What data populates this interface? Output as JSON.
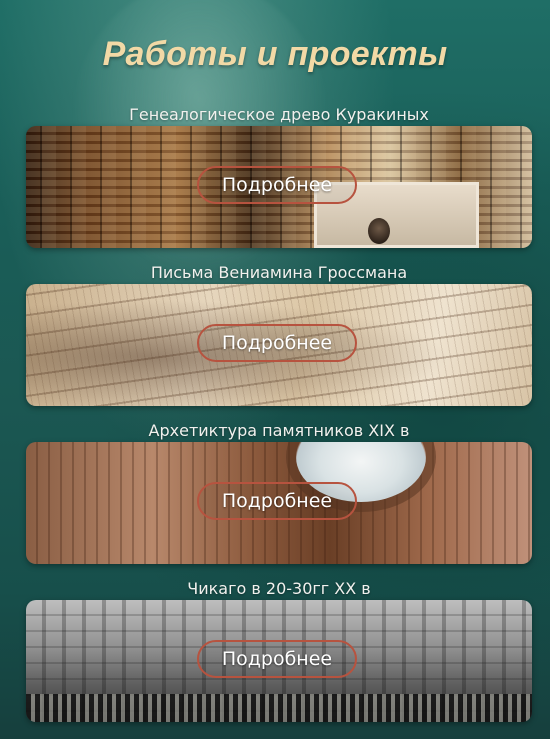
{
  "page": {
    "title": "Работы и проекты"
  },
  "projects": [
    {
      "title": "Генеалогическое древо Куракиных",
      "button_label": "Подробнее",
      "image": "old-books-and-photo"
    },
    {
      "title": "Письма Вениамина Гроссмана",
      "button_label": "Подробнее",
      "image": "handwritten-letters"
    },
    {
      "title": "Архетиктура памятников XIX в",
      "button_label": "Подробнее",
      "image": "classical-dome-interior"
    },
    {
      "title": "Чикаго в 20-30гг ХХ в",
      "button_label": "Подробнее",
      "image": "historic-chicago-street"
    }
  ],
  "colors": {
    "title": "#f2d9a6",
    "button_border": "#b7533f",
    "background": "#1b5752"
  }
}
